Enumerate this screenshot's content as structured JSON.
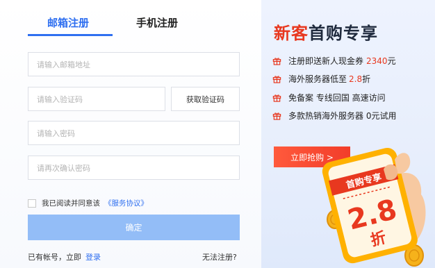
{
  "tabs": {
    "email": "邮箱注册",
    "phone": "手机注册"
  },
  "form": {
    "email_placeholder": "请输入邮箱地址",
    "code_placeholder": "请输入验证码",
    "get_code": "获取验证码",
    "password_placeholder": "请输入密码",
    "confirm_password_placeholder": "请再次确认密码",
    "agree_text": "我已阅读并同意该",
    "agreement_link": "《服务协议》",
    "confirm_button": "确定",
    "has_account": "已有帐号，立即",
    "login_link": "登录",
    "cannot_register": "无法注册?"
  },
  "promo": {
    "title_red": "新客",
    "title_dark": "首购专享",
    "benefits": [
      {
        "text": "注册即送新人现金券",
        "highlight": "2340",
        "suffix": "元"
      },
      {
        "text": "海外服务器低至",
        "highlight": "2.8",
        "suffix": "折"
      },
      {
        "text": "免备案 专线回国 高速访问",
        "highlight": "",
        "suffix": ""
      },
      {
        "text": "多款热销海外服务器 0元试用",
        "highlight": "",
        "suffix": ""
      }
    ],
    "cta": "立即抢购 >",
    "card_title": "首购专享",
    "card_value": "2.8",
    "card_unit": "折"
  },
  "colors": {
    "accent_blue": "#2f6ff0",
    "promo_red": "#e8381f",
    "button_disabled": "#93bdf7"
  },
  "icons": {
    "benefit": "gift-icon"
  }
}
